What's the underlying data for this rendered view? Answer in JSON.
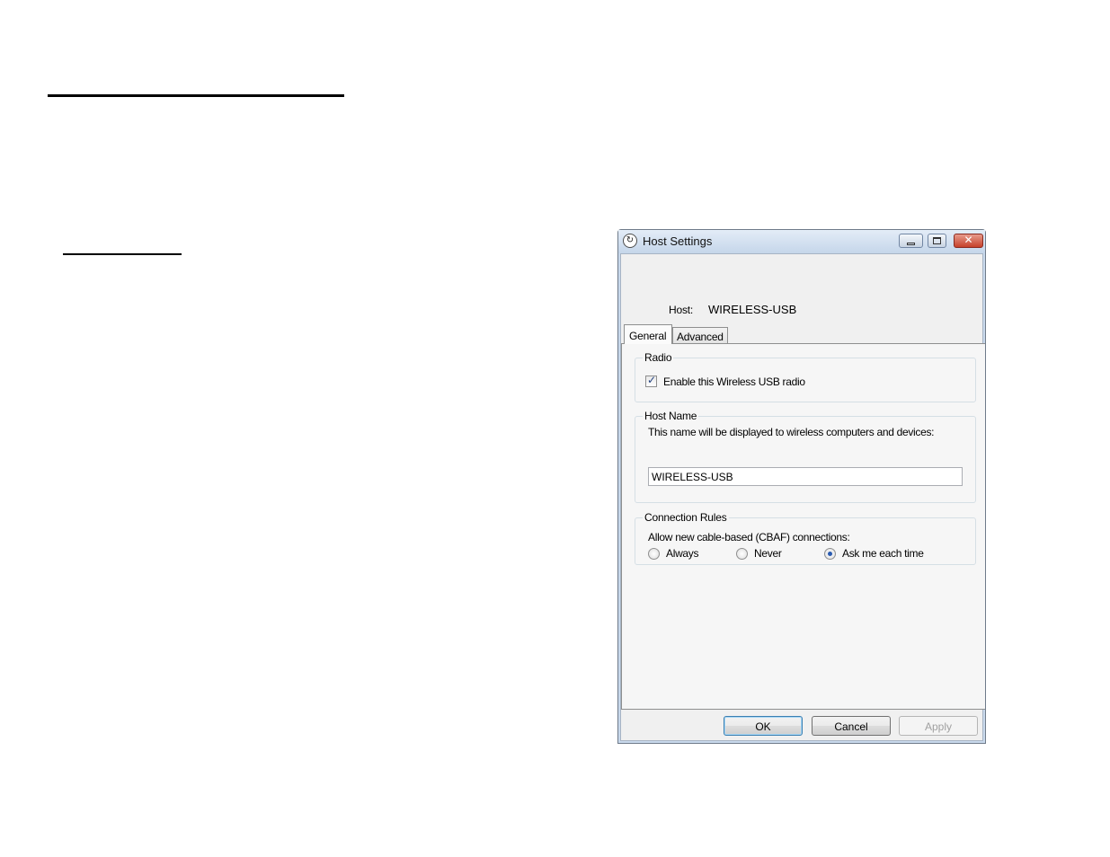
{
  "window": {
    "title": "Host Settings",
    "close_glyph": "✕"
  },
  "host": {
    "label": "Host:",
    "value": "WIRELESS-USB"
  },
  "tabs": [
    {
      "label": "General",
      "selected": true
    },
    {
      "label": "Advanced",
      "selected": false
    }
  ],
  "radio_group": {
    "title": "Radio",
    "enable_checkbox": {
      "label": "Enable this Wireless USB radio",
      "checked": true,
      "mark": "✓"
    }
  },
  "host_name_group": {
    "title": "Host Name",
    "description": "This name will be displayed to wireless computers and devices:",
    "name_value": "WIRELESS-USB"
  },
  "connection_group": {
    "title": "Connection Rules",
    "description": "Allow new cable-based (CBAF) connections:",
    "options": [
      {
        "label": "Always",
        "selected": false
      },
      {
        "label": "Never",
        "selected": false
      },
      {
        "label": "Ask me each time",
        "selected": true
      }
    ]
  },
  "buttons": {
    "ok": "OK",
    "cancel": "Cancel",
    "apply": "Apply"
  }
}
